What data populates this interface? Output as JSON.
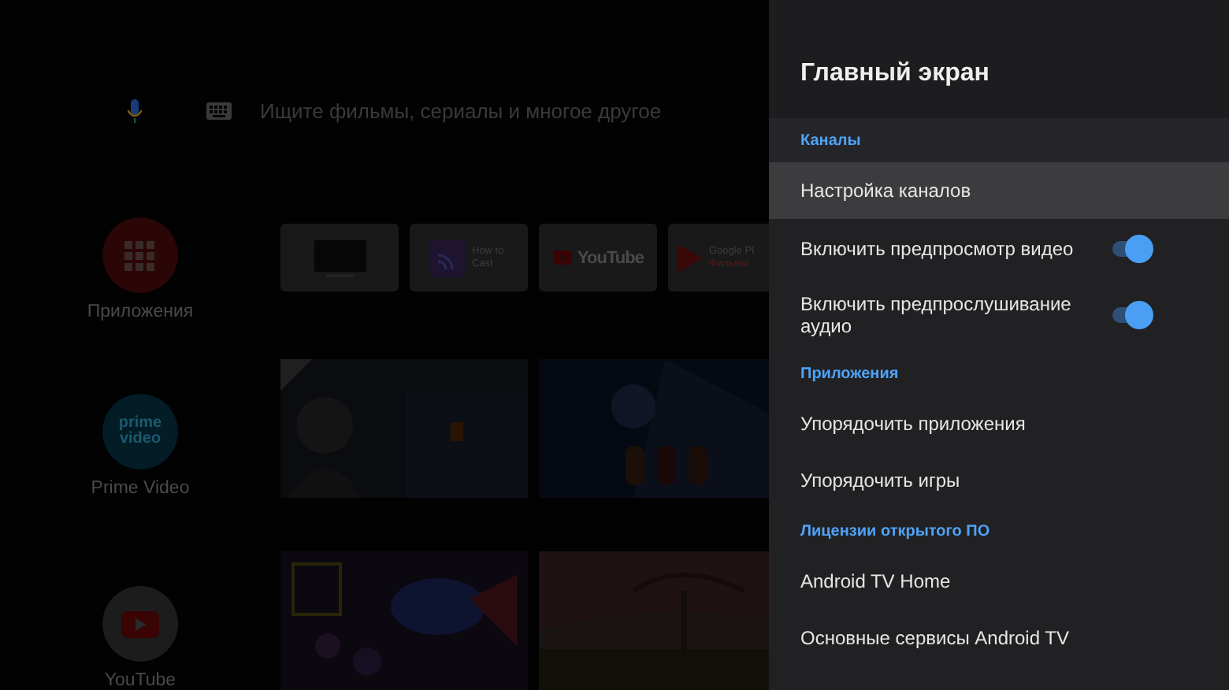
{
  "home": {
    "search": {
      "placeholder": "Ищите фильмы, сериалы и многое другое"
    },
    "apps": [
      {
        "kind": "apps",
        "label": "Приложения"
      },
      {
        "kind": "prime",
        "logo": "prime video",
        "label": "Prime Video"
      },
      {
        "kind": "youtube",
        "label": "YouTube"
      }
    ],
    "tiles": [
      {
        "kind": "tv"
      },
      {
        "kind": "cast",
        "title": "How to Cast"
      },
      {
        "kind": "youtube",
        "title": "YouTube"
      },
      {
        "kind": "play",
        "title": "Google Pl",
        "subtitle": "Фильмы"
      }
    ]
  },
  "panel": {
    "title": "Главный экран",
    "items": [
      {
        "kind": "section",
        "label": "Каналы"
      },
      {
        "kind": "link",
        "label": "Настройка каналов",
        "selected": true
      },
      {
        "kind": "toggle",
        "label": "Включить предпросмотр видео",
        "on": true,
        "selected": false
      },
      {
        "kind": "toggle",
        "label": "Включить предпрослушивание аудио",
        "on": true,
        "selected": false
      },
      {
        "kind": "section",
        "label": "Приложения"
      },
      {
        "kind": "link",
        "label": "Упорядочить приложения",
        "selected": false
      },
      {
        "kind": "link",
        "label": "Упорядочить игры",
        "selected": false
      },
      {
        "kind": "section",
        "label": "Лицензии открытого ПО"
      },
      {
        "kind": "link",
        "label": "Android TV Home",
        "selected": false
      },
      {
        "kind": "link",
        "label": "Основные сервисы Android TV",
        "selected": false
      }
    ]
  }
}
